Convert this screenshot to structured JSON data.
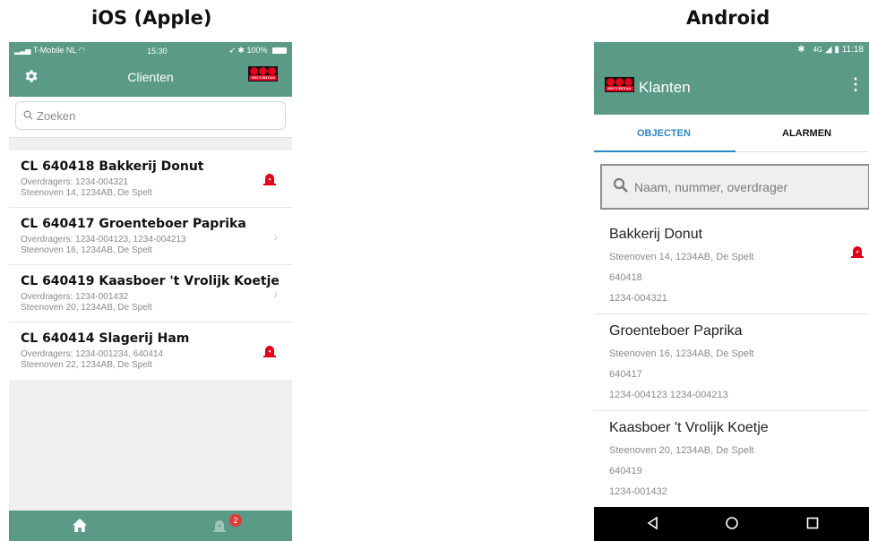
{
  "headings": {
    "ios": "iOS (Apple)",
    "android": "Android"
  },
  "ios": {
    "status": {
      "carrier": "T-Mobile NL",
      "time": "15:30",
      "battery": "100%"
    },
    "title": "Clienten",
    "logo_text": "SECURITAS",
    "search_placeholder": "Zoeken",
    "rows": [
      {
        "title": "CL 640418 Bakkerij Donut",
        "line1": "Overdragers: 1234-004321",
        "line2": "Steenoven 14, 1234AB, De Spelt",
        "trailing": "alarm-icon"
      },
      {
        "title": "CL 640417 Groenteboer Paprika",
        "line1": "Overdragers: 1234-004123, 1234-004213",
        "line2": "Steenoven 16, 1234AB, De Spelt",
        "trailing": "chevron-right-icon"
      },
      {
        "title": "CL 640419 Kaasboer 't Vrolijk Koetje",
        "line1": "Overdragers: 1234-001432",
        "line2": "Steenoven 20, 1234AB, De Spelt",
        "trailing": "chevron-right-icon"
      },
      {
        "title": "CL 640414 Slagerij Ham",
        "line1": "Overdragers: 1234-001234, 640414",
        "line2": "Steenoven 22, 1234AB, De Spelt",
        "trailing": "alarm-icon"
      }
    ],
    "tabbar": {
      "badge": "2"
    }
  },
  "android": {
    "status": {
      "network": "4G",
      "time": "11:18"
    },
    "title": "Klanten",
    "logo_text": "SECURITAS",
    "tabs": [
      "OBJECTEN",
      "ALARMEN"
    ],
    "search_placeholder": "Naam, nummer, overdrager",
    "rows": [
      {
        "name": "Bakkerij Donut",
        "address": "Steenoven 14, 1234AB, De Spelt",
        "number": "640418",
        "overdragers": "1234-004321",
        "alarm": true
      },
      {
        "name": "Groenteboer Paprika",
        "address": "Steenoven 16, 1234AB, De Spelt",
        "number": "640417",
        "overdragers": "1234-004123 1234-004213",
        "alarm": false
      },
      {
        "name": "Kaasboer 't Vrolijk Koetje",
        "address": "Steenoven 20, 1234AB, De Spelt",
        "number": "640419",
        "overdragers": "1234-001432",
        "alarm": false
      }
    ]
  },
  "colors": {
    "brand_green": "#5a9a87",
    "alarm_red": "#e2001a",
    "tab_blue": "#2d87c5"
  }
}
